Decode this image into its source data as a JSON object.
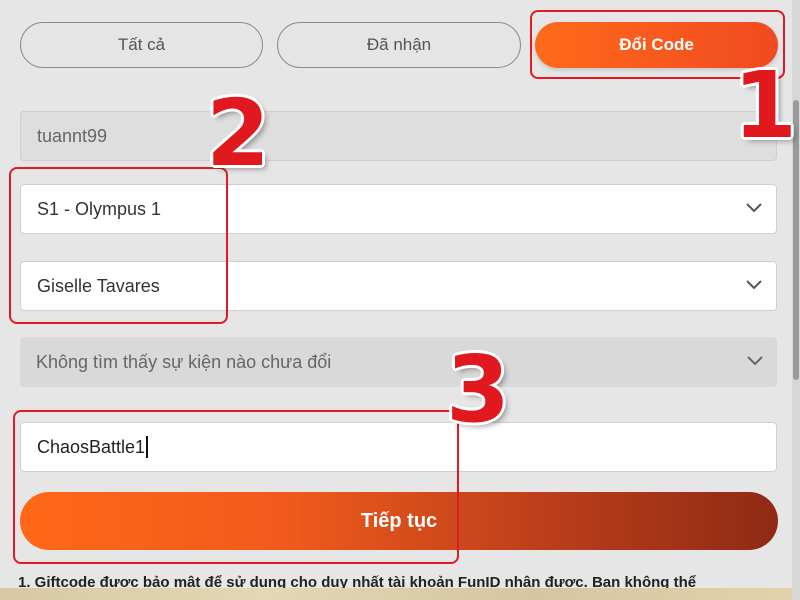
{
  "tabs": [
    {
      "label": "Tất cả",
      "active": false
    },
    {
      "label": "Đã nhận",
      "active": false
    },
    {
      "label": "Đổi Code",
      "active": true
    }
  ],
  "form": {
    "username": "tuannt99",
    "server": "S1 - Olympus 1",
    "character": "Giselle Tavares",
    "event_placeholder": "Không tìm thấy sự kiện nào chưa đổi",
    "code_value": "ChaosBattle1",
    "submit_label": "Tiếp tục"
  },
  "annotations": {
    "step1": "1",
    "step2": "2",
    "step3": "3"
  },
  "note_text": "1. Giftcode được bảo mật để sử dụng cho duy nhất tài khoản FunID nhận được. Bạn không thể",
  "colors": {
    "accent": "#ff6a1a",
    "annotation_red": "#e0191f"
  }
}
